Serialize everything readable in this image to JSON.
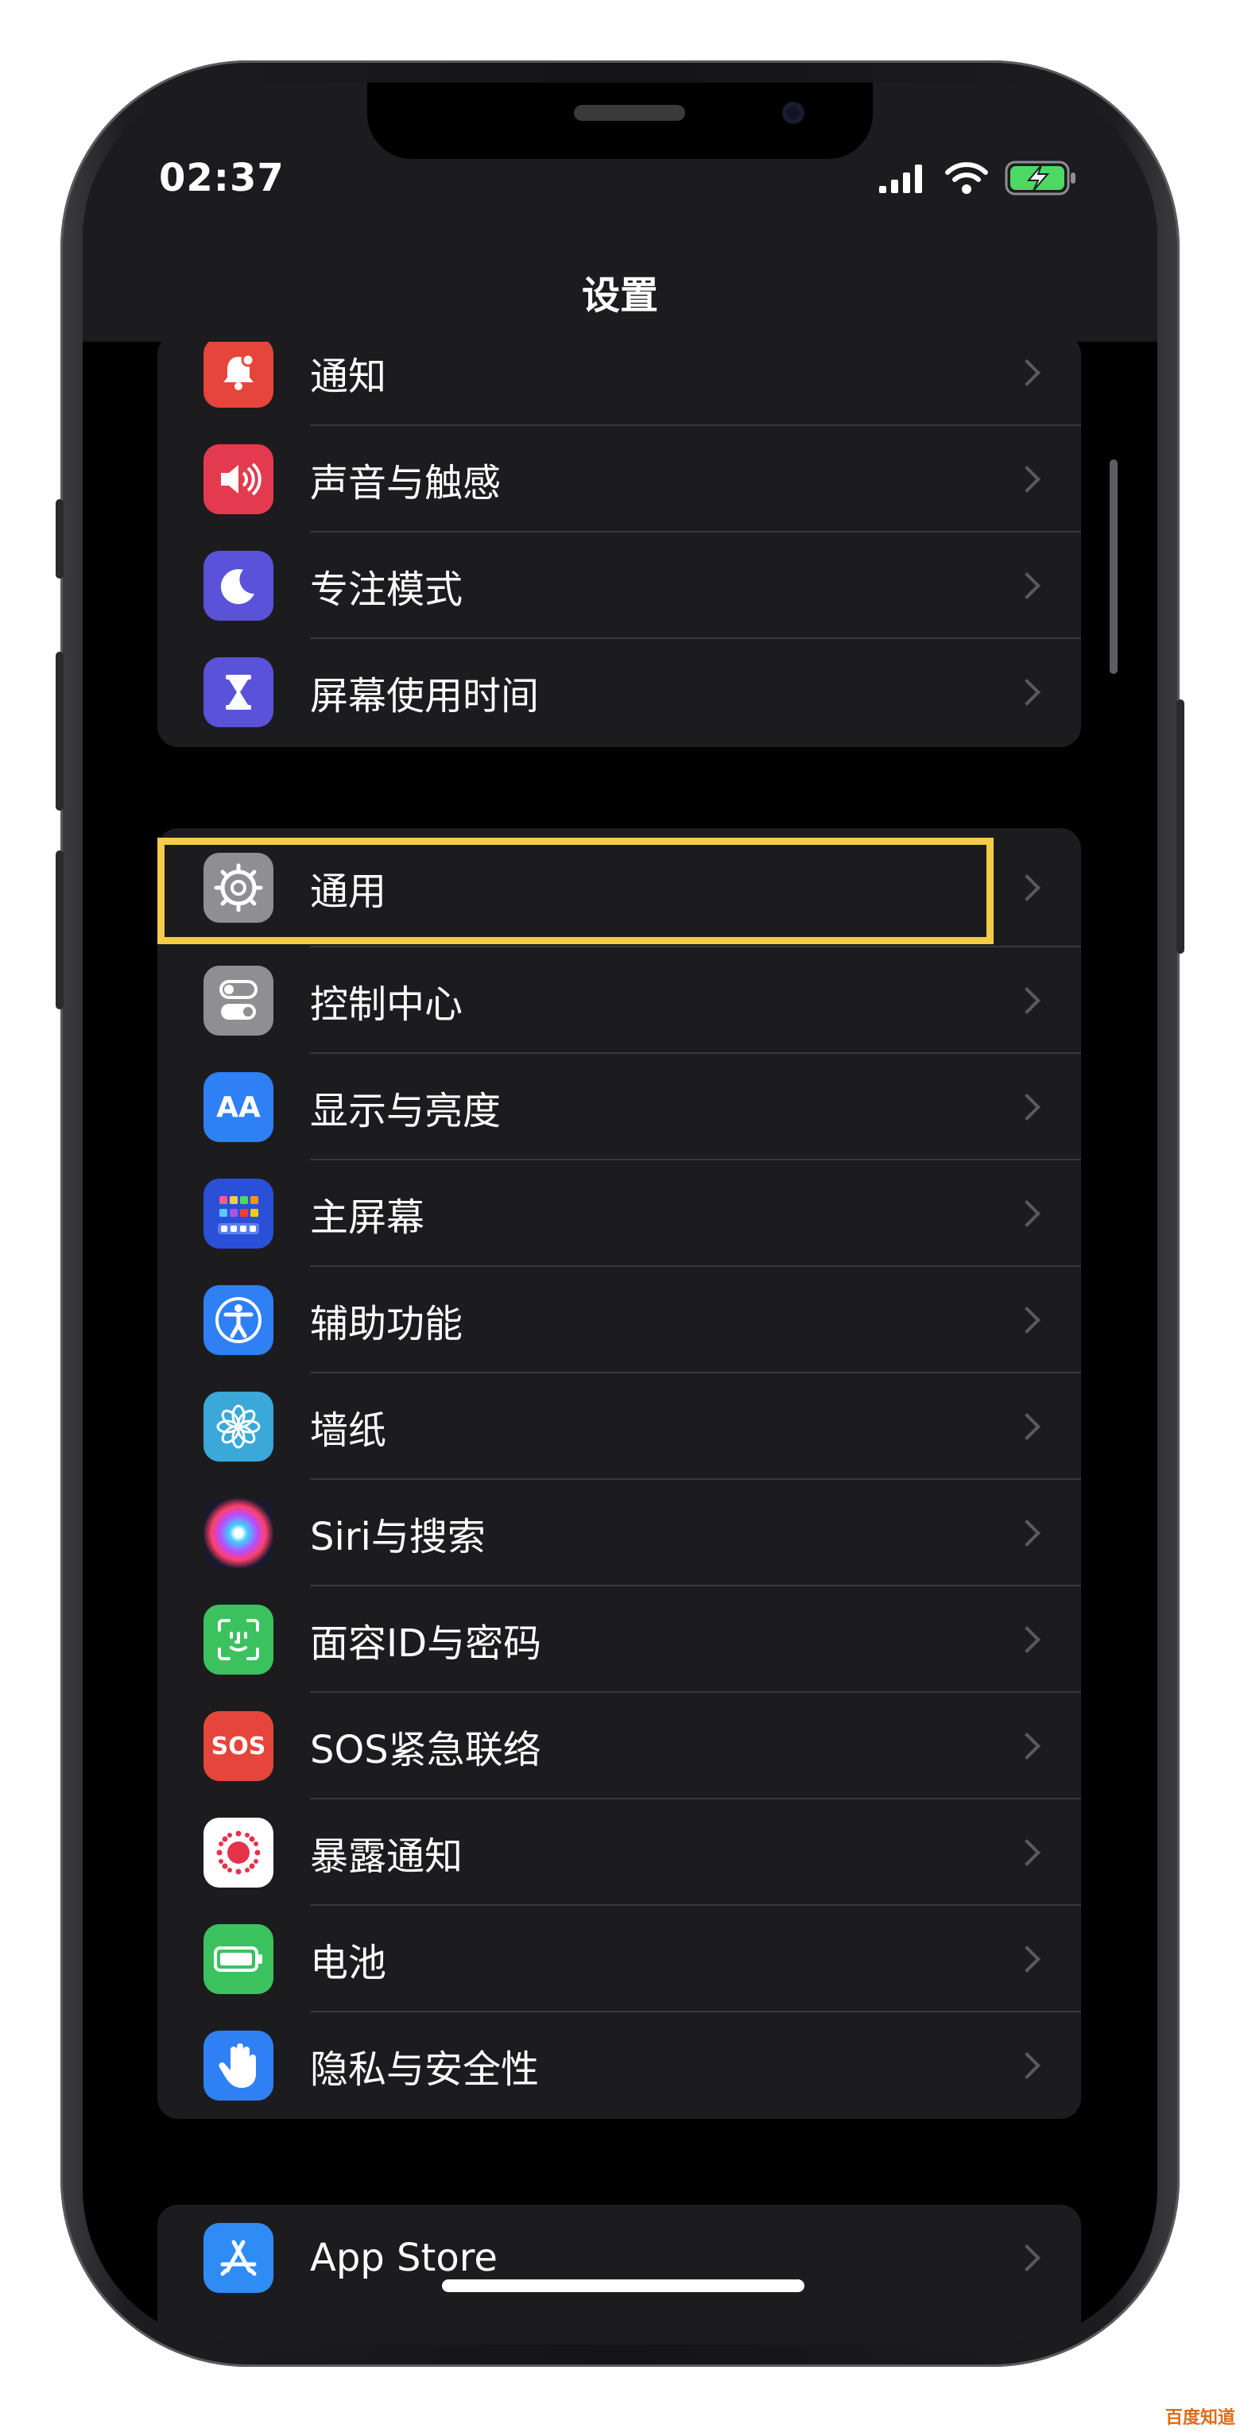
{
  "status_bar": {
    "time": "02:37"
  },
  "nav": {
    "title": "设置"
  },
  "groups": [
    {
      "items": [
        {
          "label": "通知",
          "icon": "bell-icon",
          "color": "#e5453b"
        },
        {
          "label": "声音与触感",
          "icon": "speaker-icon",
          "color": "#e33a4f"
        },
        {
          "label": "专注模式",
          "icon": "moon-icon",
          "color": "#5a52d8"
        },
        {
          "label": "屏幕使用时间",
          "icon": "hourglass-icon",
          "color": "#5a52d8"
        }
      ]
    },
    {
      "items": [
        {
          "label": "通用",
          "icon": "gear-icon",
          "color": "#8e8e93",
          "highlighted": true
        },
        {
          "label": "控制中心",
          "icon": "toggles-icon",
          "color": "#8e8e93"
        },
        {
          "label": "显示与亮度",
          "icon": "aa-icon",
          "color": "#2f7ff5",
          "glyph": "AA"
        },
        {
          "label": "主屏幕",
          "icon": "home-screen-icon",
          "color": "#2a50d8"
        },
        {
          "label": "辅助功能",
          "icon": "accessibility-icon",
          "color": "#2f7ff5"
        },
        {
          "label": "墙纸",
          "icon": "flower-icon",
          "color": "#3aa8d8"
        },
        {
          "label": "Siri与搜索",
          "icon": "siri-icon",
          "color": "#1a1a2e"
        },
        {
          "label": "面容ID与密码",
          "icon": "face-id-icon",
          "color": "#3cc15f"
        },
        {
          "label": "SOS紧急联络",
          "icon": "sos-icon",
          "color": "#e5453b",
          "glyph": "SOS"
        },
        {
          "label": "暴露通知",
          "icon": "exposure-icon",
          "color": "#ffffff"
        },
        {
          "label": "电池",
          "icon": "battery-icon",
          "color": "#3cc15f"
        },
        {
          "label": "隐私与安全性",
          "icon": "hand-icon",
          "color": "#2f7ff5"
        }
      ]
    },
    {
      "items": [
        {
          "label": "App Store",
          "icon": "app-store-icon",
          "color": "#2f8cf5"
        }
      ]
    }
  ],
  "highlight_color": "#f6cb4a",
  "watermark": "百度知道"
}
